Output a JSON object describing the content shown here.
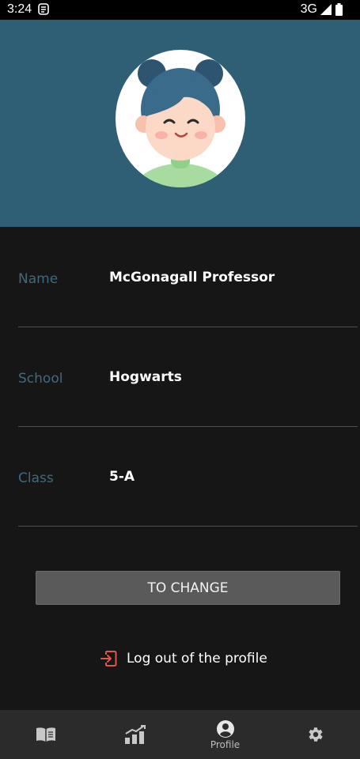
{
  "status_bar": {
    "time": "3:24",
    "network": "3G"
  },
  "profile": {
    "avatar_icon": "avatar-girl-icon",
    "fields": [
      {
        "label": "Name",
        "value": "McGonagall Professor"
      },
      {
        "label": "School",
        "value": "Hogwarts"
      },
      {
        "label": "Class",
        "value": "5-A"
      }
    ]
  },
  "actions": {
    "change_label": "TO CHANGE",
    "logout_label": "Log out of the profile"
  },
  "bottom_nav": {
    "items": [
      {
        "icon": "book-icon",
        "label": ""
      },
      {
        "icon": "chart-icon",
        "label": ""
      },
      {
        "icon": "account-icon",
        "label": "Profile"
      },
      {
        "icon": "gear-icon",
        "label": ""
      }
    ],
    "active_index": 2
  },
  "colors": {
    "header_bg": "#2f5f74",
    "background": "#161616",
    "label": "#3d6a80",
    "logout_icon": "#e0564b",
    "nav_bg": "#2b2b2b"
  }
}
